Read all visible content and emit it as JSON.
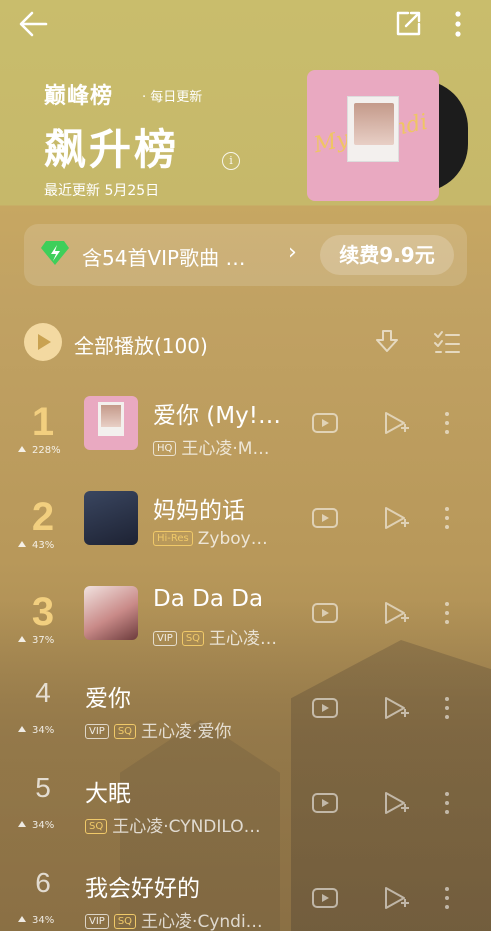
{
  "header": {
    "brand": "巅峰榜",
    "brand_sub": "· 每日更新",
    "title": "飙升榜",
    "info": "i",
    "updated": "最近更新 5月25日"
  },
  "vip": {
    "text": "含54首VIP歌曲 …",
    "chevron": "›",
    "renew": "续费9.9元"
  },
  "toolbar": {
    "play_all": "全部播放(100)"
  },
  "songs": [
    {
      "rank": "1",
      "trend": "228%",
      "title": "爱你 (My!…",
      "badges": [
        "HQ"
      ],
      "meta": "王心凌·M…"
    },
    {
      "rank": "2",
      "trend": "43%",
      "title": "妈妈的话",
      "badges": [
        "Hi-Res"
      ],
      "meta": "Zyboy…"
    },
    {
      "rank": "3",
      "trend": "37%",
      "title": "Da Da Da",
      "badges": [
        "VIP",
        "SQ"
      ],
      "meta": "王心凌…"
    },
    {
      "rank": "4",
      "trend": "34%",
      "title": "爱你",
      "badges": [
        "VIP",
        "SQ"
      ],
      "meta": "王心凌·爱你"
    },
    {
      "rank": "5",
      "trend": "34%",
      "title": "大眠",
      "badges": [
        "SQ"
      ],
      "meta": "王心凌·CYNDILO…"
    },
    {
      "rank": "6",
      "trend": "34%",
      "title": "我会好好的",
      "badges": [
        "VIP",
        "SQ"
      ],
      "meta": "王心凌·Cyndi…"
    }
  ],
  "icons": {
    "back": "back-arrow-icon",
    "share": "share-icon",
    "more": "more-vertical-icon",
    "vip": "vip-diamond-icon",
    "play": "play-icon",
    "download": "download-icon",
    "multi": "multi-select-icon",
    "mv": "mv-icon",
    "add": "add-to-playlist-icon"
  },
  "colors": {
    "rank_top": "#f2cf7f",
    "vip_green": "#3ecf5a",
    "badge_gold": "#f0c969"
  }
}
